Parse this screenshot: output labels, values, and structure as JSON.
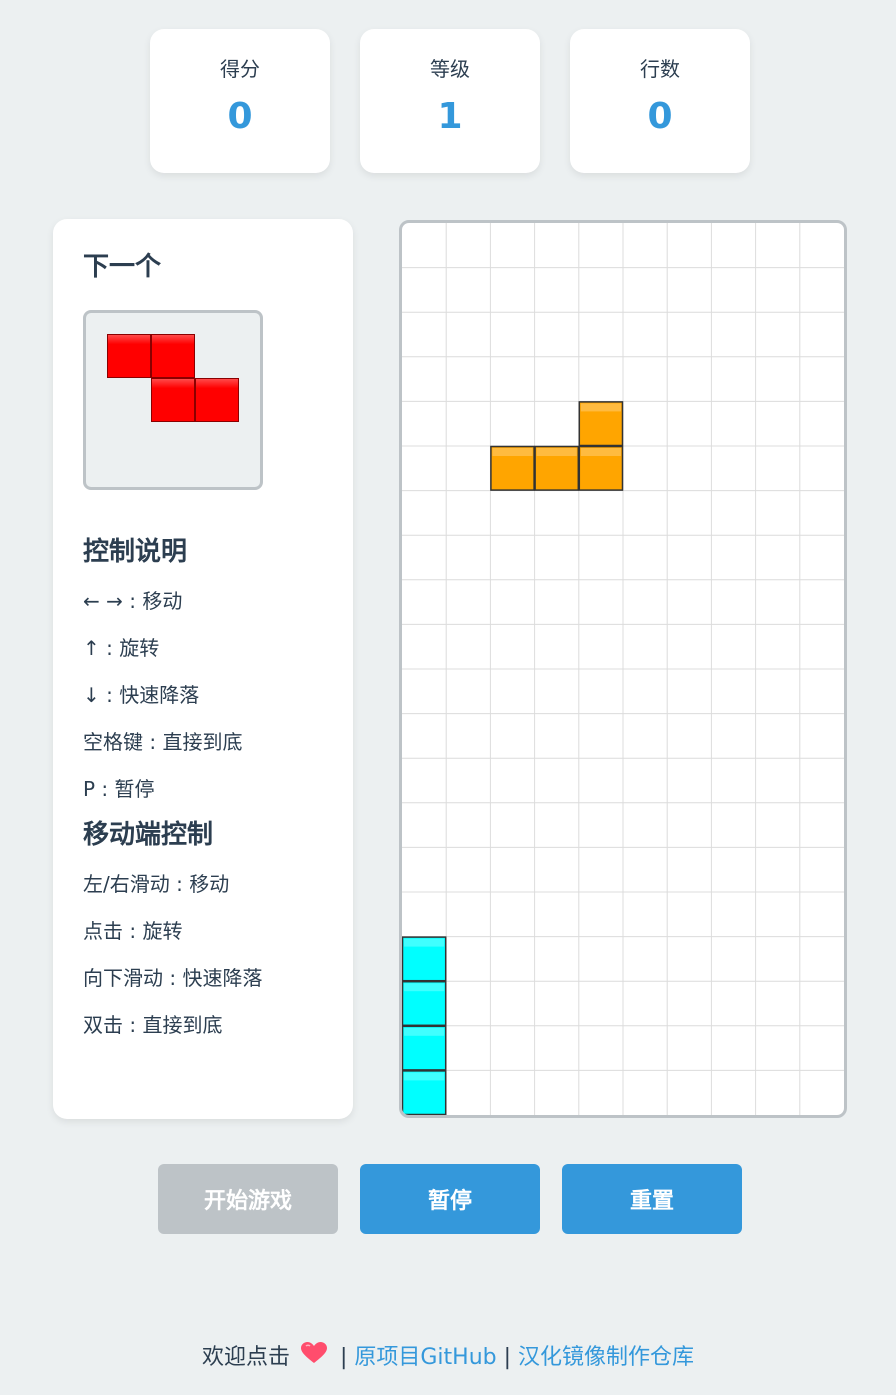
{
  "stats": {
    "score_label": "得分",
    "score_value": "0",
    "level_label": "等级",
    "level_value": "1",
    "lines_label": "行数",
    "lines_value": "0"
  },
  "side_panel": {
    "next_title": "下一个",
    "next_piece": {
      "color": "#ff0000",
      "cells": [
        [
          0,
          0
        ],
        [
          1,
          0
        ],
        [
          1,
          1
        ],
        [
          2,
          1
        ]
      ]
    },
    "controls_title": "控制说明",
    "controls": [
      "← → : 移动",
      "↑ : 旋转",
      "↓ : 快速降落",
      "空格键 : 直接到底",
      "P : 暂停"
    ],
    "mobile_title": "移动端控制",
    "mobile_controls": [
      "左/右滑动 : 移动",
      "点击 : 旋转",
      "向下滑动 : 快速降落",
      "双击 : 直接到底"
    ]
  },
  "board": {
    "cols": 10,
    "rows": 20,
    "grid_color": "#dcdcdc",
    "pieces": [
      {
        "name": "active-piece-orange",
        "color": "#ffa500",
        "cells": [
          [
            4,
            4
          ],
          [
            2,
            5
          ],
          [
            3,
            5
          ],
          [
            4,
            5
          ]
        ]
      },
      {
        "name": "locked-piece-cyan",
        "color": "#00ffff",
        "cells": [
          [
            0,
            16
          ],
          [
            0,
            17
          ],
          [
            0,
            18
          ],
          [
            0,
            19
          ]
        ]
      }
    ]
  },
  "buttons": {
    "start_label": "开始游戏",
    "pause_label": "暂停",
    "reset_label": "重置"
  },
  "footer": {
    "welcome": "欢迎点击",
    "separator": "|",
    "github_link": "原项目GitHub",
    "mirror_link": "汉化镜像制作仓库"
  },
  "colors": {
    "accent": "#3498db",
    "background": "#ecf0f1",
    "disabled_button": "#bdc3c7",
    "text": "#2c3e50",
    "heart": "#ff4d6d"
  }
}
